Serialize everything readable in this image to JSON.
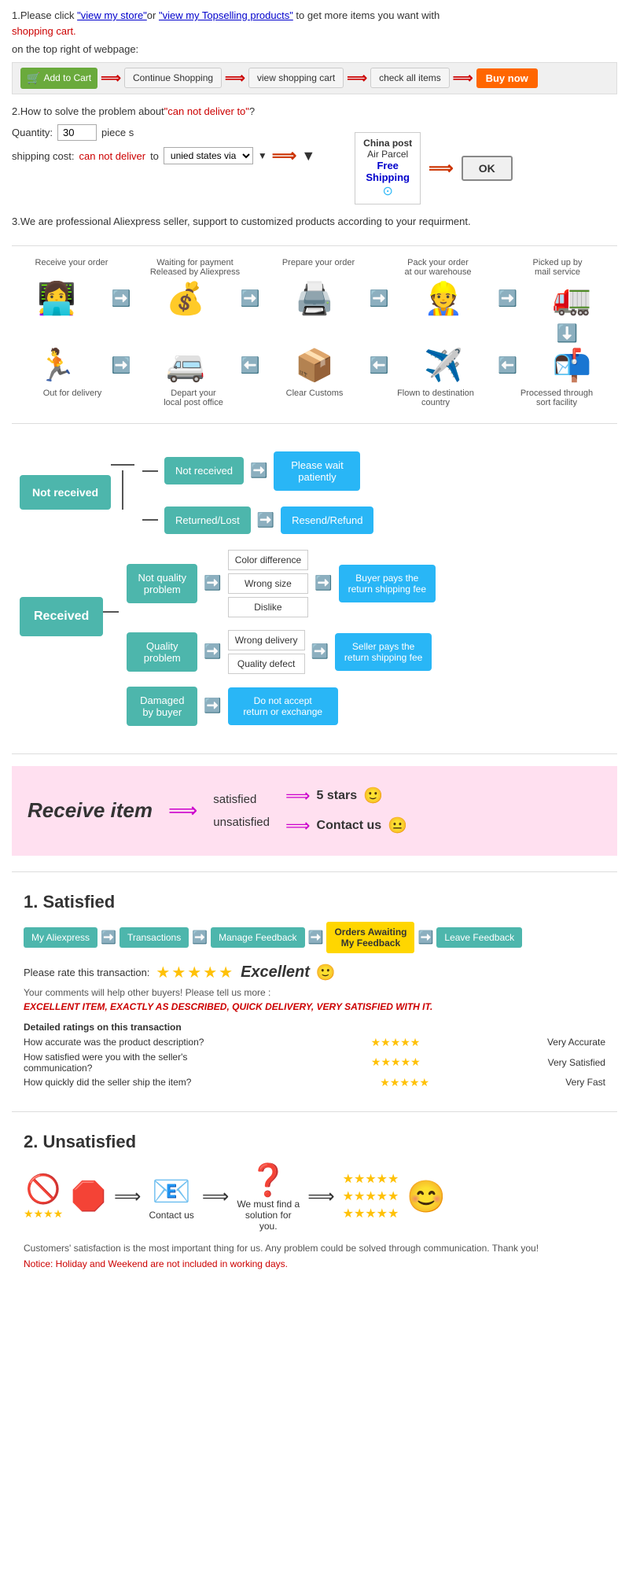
{
  "section1": {
    "text1": "1.Please click ",
    "link1": "\"view my store\"",
    "text2": "or ",
    "link2": "\"view my Topselling products\"",
    "text3": " to get more items you want with",
    "link3": "shopping cart.",
    "text4": "on the top right of webpage:",
    "btn_cart": "Add to Cart",
    "btn_continue": "Continue Shopping",
    "btn_view": "view shopping cart",
    "btn_check": "check all items",
    "btn_buy": "Buy now"
  },
  "section2": {
    "title": "2.How to solve the problem about",
    "problem": "\"can not deliver to\"",
    "text": "?",
    "qty_label": "Quantity:",
    "qty_value": "30",
    "qty_unit": "piece s",
    "shipping_label": "shipping cost:",
    "cannot_deliver": "can not deliver",
    "to_text": " to ",
    "via_text": "unied states via",
    "china_post_line1": "China post",
    "china_post_line2": "Air Parcel",
    "free_text": "Free",
    "shipping_text": "Shipping",
    "ok_btn": "OK"
  },
  "section3": {
    "title": "3.We are professional Aliexpress seller, support to customized products according to your requirment."
  },
  "process": {
    "top_labels": [
      "Receive your order",
      "Waiting for payment\nReleased by Aliexpress",
      "Prepare your order",
      "Pack your order\nat our warehouse",
      "Picked up by\nmail service"
    ],
    "top_icons": [
      "💻",
      "💰",
      "🖨️",
      "👷",
      "🚛"
    ],
    "bottom_icons": [
      "🏃",
      "🚐",
      "📦",
      "✈️",
      "📫"
    ],
    "bottom_labels": [
      "Out for delivery",
      "Depart your\nlocal post office",
      "Clear Customs",
      "Flown to destination\ncountry",
      "Processed through\nsort facility"
    ]
  },
  "flowchart_not_received": {
    "main": "Not received",
    "branch1": "Not received",
    "outcome1": "Please wait\npatiently",
    "branch2": "Returned/Lost",
    "outcome2": "Resend/Refund"
  },
  "flowchart_received": {
    "main": "Received",
    "nqp": "Not quality\nproblem",
    "nqp_sub": [
      "Color difference",
      "Wrong size",
      "Dislike"
    ],
    "nqp_result": "Buyer pays the\nreturn shipping fee",
    "qp": "Quality\nproblem",
    "qp_sub": [
      "Wrong delivery",
      "Quality defect"
    ],
    "qp_result": "Seller pays the\nreturn shipping fee",
    "damaged": "Damaged\nby buyer",
    "damaged_result": "Do not accept\nreturn or exchange"
  },
  "receive_item": {
    "title": "Receive item",
    "arrow": "→",
    "satisfied": "satisfied",
    "unsatisfied": "unsatisfied",
    "result1": "5 stars",
    "result2": "Contact us",
    "emoji1": "🙂",
    "emoji2": "😐"
  },
  "satisfied": {
    "number": "1.",
    "title": "Satisfied",
    "tab1": "My Aliexpress",
    "tab2": "Transactions",
    "tab3": "Manage Feedback",
    "tab4": "Orders Awaiting\nMy Feedback",
    "tab5": "Leave Feedback",
    "rate_text": "Please rate this transaction:",
    "excellent": "Excellent",
    "smiley": "🙂",
    "comment1": "Your comments will help other buyers! Please tell us more :",
    "review": "EXCELLENT ITEM, EXACTLY AS DESCRIBED, QUICK DELIVERY, VERY SATISFIED WITH IT.",
    "detailed_title": "Detailed ratings on this transaction",
    "r1_label": "How accurate was the product description?",
    "r1_result": "Very Accurate",
    "r2_label": "How satisfied were you with the seller's communication?",
    "r2_result": "Very Satisfied",
    "r3_label": "How quickly did the seller ship the item?",
    "r3_result": "Very Fast"
  },
  "unsatisfied": {
    "number": "2.",
    "title": "Unsatisfied",
    "notice": "Customers' satisfaction is the most important thing for us. Any problem could be solved through communication. Thank you!",
    "notice_red": "Notice: Holiday and Weekend are not included in working days.",
    "contact_label": "Contact us",
    "solution_label": "We must find\na solution for\nyou."
  }
}
